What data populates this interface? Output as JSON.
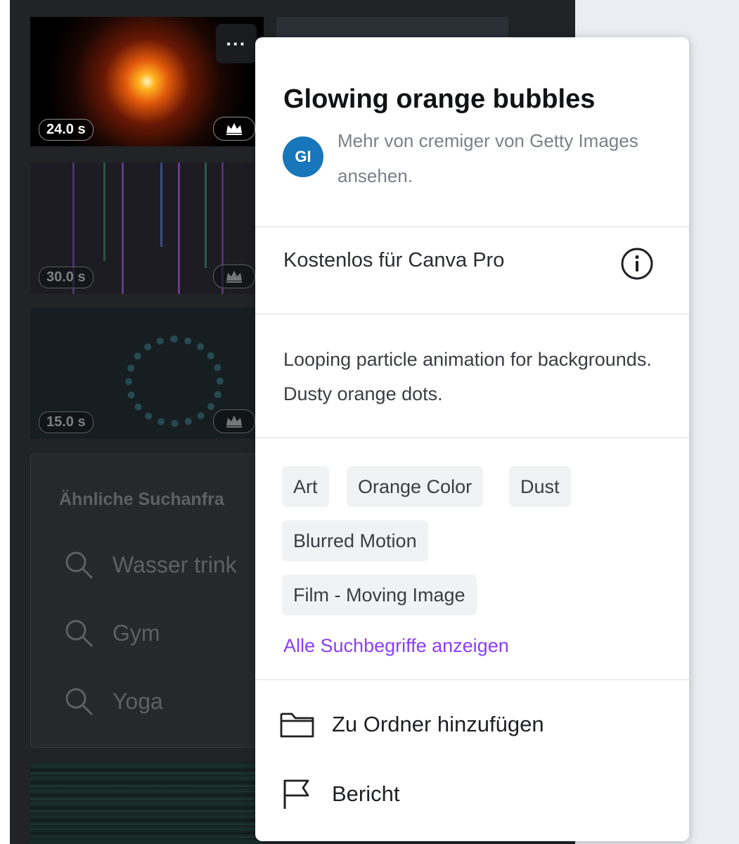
{
  "thumbnails": [
    {
      "duration": "24.0 s"
    },
    {
      "duration": "30.0 s"
    },
    {
      "duration": "15.0 s"
    }
  ],
  "more_button": {
    "label": "···"
  },
  "similar_searches": {
    "title": "Ähnliche Suchanfra",
    "items": [
      {
        "label": "Wasser trink"
      },
      {
        "label": "Gym"
      },
      {
        "label": "Yoga"
      }
    ]
  },
  "popover": {
    "title": "Glowing orange bubbles",
    "author": {
      "initials": "GI",
      "text": "Mehr von cremiger von Getty Images ansehen."
    },
    "license": {
      "text": "Kostenlos für Canva Pro"
    },
    "description": "Looping particle animation for backgrounds. Dusty orange dots.",
    "tags": [
      "Art",
      "Orange Color",
      "Dust",
      "Blurred Motion",
      "Film - Moving Image"
    ],
    "see_all_label": "Alle Suchbegriffe anzeigen",
    "actions": {
      "add_to_folder": "Zu Ordner hinzufügen",
      "report": "Bericht"
    }
  },
  "colors": {
    "accent_link": "#8b3dff",
    "avatar_bg": "#1876ba",
    "panel_dark": "#212326"
  }
}
